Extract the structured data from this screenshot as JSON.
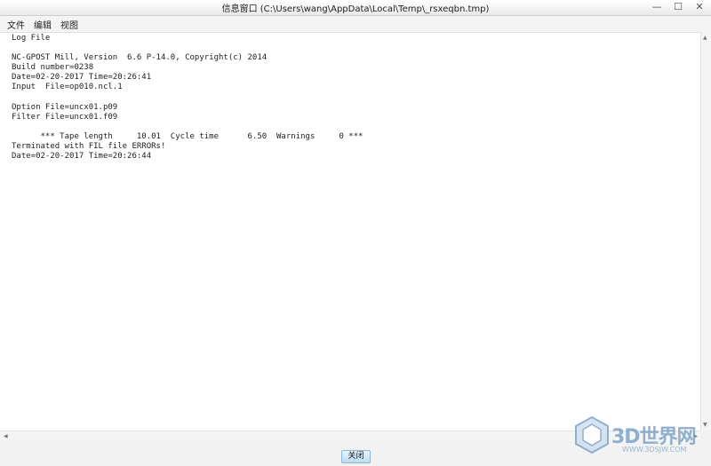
{
  "window": {
    "title": "信息窗口 (C:\\Users\\wang\\AppData\\Local\\Temp\\_rsxeqbn.tmp)",
    "minimize": "—",
    "maximize": "☐",
    "close": "✕"
  },
  "menu": {
    "items": [
      "文件",
      "编辑",
      "视图"
    ]
  },
  "log_lines": [
    "Log File",
    "",
    "NC-GPOST Mill, Version  6.6 P-14.0, Copyright(c) 2014",
    "Build number=0238",
    "Date=02-20-2017 Time=20:26:41",
    "Input  File=op010.ncl.1",
    "",
    "Option File=uncx01.p09",
    "Filter File=uncx01.f09",
    "",
    "      *** Tape length     10.01  Cycle time      6.50  Warnings     0 ***",
    "Terminated with FIL file ERRORs!",
    "Date=02-20-2017 Time=20:26:44"
  ],
  "footer": {
    "close_label": "关闭"
  },
  "watermark": {
    "logo_text": "3D世界网",
    "url": "WWW.3DSJW.COM"
  },
  "colors": {
    "button_bg": "#bcdcf2",
    "watermark": "#7ea3c9"
  }
}
